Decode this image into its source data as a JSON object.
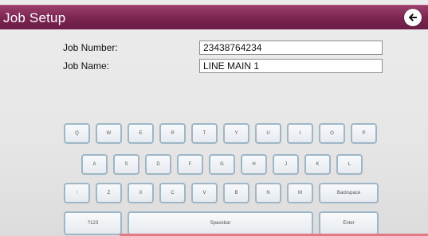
{
  "header": {
    "title": "Job Setup",
    "back_icon": "arrow-left-icon"
  },
  "form": {
    "job_number_label": "Job Number:",
    "job_number_value": "23438764234",
    "job_name_label": "Job Name:",
    "job_name_value": "LINE MAIN 1"
  },
  "keyboard": {
    "row1": [
      "Q",
      "W",
      "E",
      "R",
      "T",
      "Y",
      "U",
      "I",
      "O",
      "P"
    ],
    "row2": [
      "A",
      "S",
      "D",
      "F",
      "G",
      "H",
      "J",
      "K",
      "L"
    ],
    "row3": [
      "↑",
      "Z",
      "X",
      "C",
      "V",
      "B",
      "N",
      "M"
    ],
    "backspace": "Backspace",
    "numeric": "?123",
    "spacebar": "Spacebar",
    "enter": "Enter"
  },
  "colors": {
    "titlebar": "#7a2450",
    "key_border": "#9fb6c6"
  }
}
